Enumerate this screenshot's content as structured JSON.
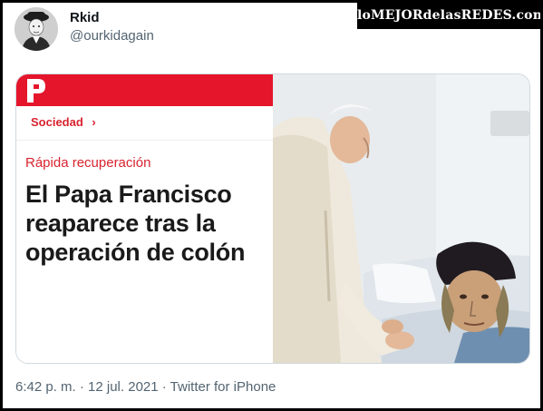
{
  "tweet": {
    "display_name": "Rkid",
    "handle": "@ourkidagain",
    "timestamp": "6:42 p. m. · 12 jul. 2021",
    "separator": " · ",
    "source": "Twitter for iPhone"
  },
  "watermark": {
    "text": "loMEJORdelasREDES.com"
  },
  "article": {
    "section": "Sociedad",
    "section_chevron": "›",
    "kicker": "Rápida recuperación",
    "headline": "El Papa Francisco reaparece tras la operación de colón"
  },
  "colors": {
    "brand_red": "#e5152c",
    "section_red": "#d8232f",
    "secondary_text": "#536471"
  },
  "icons": [
    "avatar-image",
    "newspaper-logo-icon",
    "chevron-right-icon"
  ]
}
